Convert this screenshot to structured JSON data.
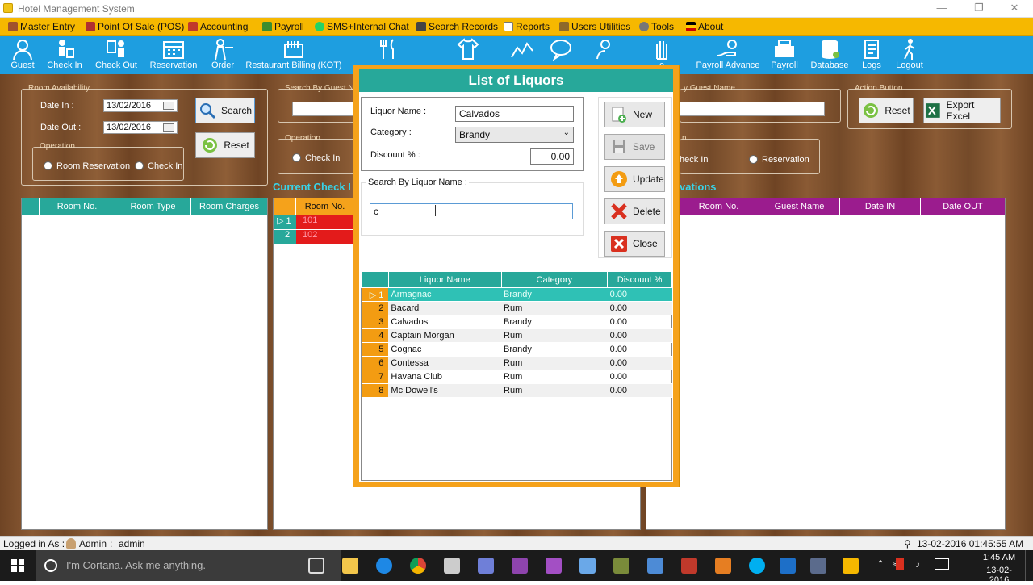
{
  "window": {
    "title": "Hotel Management System"
  },
  "menu": [
    {
      "label": "Master Entry",
      "icon": "book-icon"
    },
    {
      "label": "Point Of Sale (POS)",
      "icon": "pos-icon"
    },
    {
      "label": "Accounting",
      "icon": "ledger-icon"
    },
    {
      "label": "Payroll",
      "icon": "money-icon"
    },
    {
      "label": "SMS+Internal Chat",
      "icon": "whatsapp-icon"
    },
    {
      "label": "Search Records",
      "icon": "binoculars-icon"
    },
    {
      "label": "Reports",
      "icon": "report-icon"
    },
    {
      "label": "Users Utilities",
      "icon": "users-icon"
    },
    {
      "label": "Tools",
      "icon": "gear-icon"
    },
    {
      "label": "About",
      "icon": "flag-icon"
    }
  ],
  "toolbar": [
    {
      "label": "Guest"
    },
    {
      "label": "Check In"
    },
    {
      "label": "Check Out"
    },
    {
      "label": "Reservation"
    },
    {
      "label": "Order"
    },
    {
      "label": "Restaurant Billing (KOT)"
    },
    {
      "label": ""
    },
    {
      "label": ""
    },
    {
      "label": ""
    },
    {
      "label": ""
    },
    {
      "label": ""
    },
    {
      "label": "e"
    },
    {
      "label": "Payroll Advance"
    },
    {
      "label": "Payroll"
    },
    {
      "label": "Database"
    },
    {
      "label": "Logs"
    },
    {
      "label": "Logout"
    }
  ],
  "room_availability": {
    "group_label": "Room Availability",
    "date_in_label": "Date In :",
    "date_in": "13/02/2016",
    "date_out_label": "Date Out :",
    "date_out": "13/02/2016",
    "search_label": "Search",
    "reset_label": "Reset",
    "operation_label": "Operation",
    "radio_reservation": "Room Reservation",
    "radio_checkin": "Check In",
    "columns": [
      "Room No.",
      "Room Type",
      "Room Charges"
    ]
  },
  "middle": {
    "search_group": "Search By Guest N",
    "operation_label": "Operation",
    "radio_checkin": "Check In",
    "section_title": "Current Check I",
    "col_room": "Room No.",
    "rows": [
      {
        "n": "1",
        "v": "101"
      },
      {
        "n": "2",
        "v": "102"
      }
    ]
  },
  "right": {
    "search_group": "y Guest Name",
    "action_group": "Action Button",
    "reset_label": "Reset",
    "export_label": "Export Excel",
    "op_partial": "n",
    "radio_checkin": "heck In",
    "radio_reservation": "Reservation",
    "section_title": "vations",
    "columns": [
      "Room No.",
      "Guest Name",
      "Date IN",
      "Date OUT"
    ]
  },
  "dialog": {
    "title": "List of Liquors",
    "liquor_name_label": "Liquor Name :",
    "liquor_name_value": "Calvados",
    "category_label": "Category :",
    "category_value": "Brandy",
    "discount_label": "Discount % :",
    "discount_value": "0.00",
    "search_label": "Search By Liquor Name :",
    "search_value": "c",
    "buttons": {
      "new": "New",
      "save": "Save",
      "update": "Update",
      "delete": "Delete",
      "close": "Close"
    },
    "grid_columns": [
      "Liquor Name",
      "Category",
      "Discount %"
    ],
    "rows": [
      {
        "n": "1",
        "name": "Armagnac",
        "cat": "Brandy",
        "disc": "0.00"
      },
      {
        "n": "2",
        "name": "Bacardi",
        "cat": "Rum",
        "disc": "0.00"
      },
      {
        "n": "3",
        "name": "Calvados",
        "cat": "Brandy",
        "disc": "0.00"
      },
      {
        "n": "4",
        "name": "Captain Morgan",
        "cat": "Rum",
        "disc": "0.00"
      },
      {
        "n": "5",
        "name": "Cognac",
        "cat": "Brandy",
        "disc": "0.00"
      },
      {
        "n": "6",
        "name": "Contessa",
        "cat": "Rum",
        "disc": "0.00"
      },
      {
        "n": "7",
        "name": "Havana Club",
        "cat": "Rum",
        "disc": "0.00"
      },
      {
        "n": "8",
        "name": "Mc Dowell's",
        "cat": "Rum",
        "disc": "0.00"
      }
    ]
  },
  "status": {
    "logged_in_label": "Logged in As :",
    "user": "Admin",
    "sep": ":",
    "username": "admin",
    "datetime": "13-02-2016 01:45:55 AM"
  },
  "taskbar": {
    "cortana": "I'm Cortana. Ask me anything.",
    "time": "1:45 AM",
    "date": "13-02-2016"
  },
  "colors": {
    "menu": "#f6b800",
    "toolbar": "#1e9ee0",
    "teal": "#27a89a",
    "orange": "#f5a21b",
    "purple": "#9b1c8e"
  }
}
